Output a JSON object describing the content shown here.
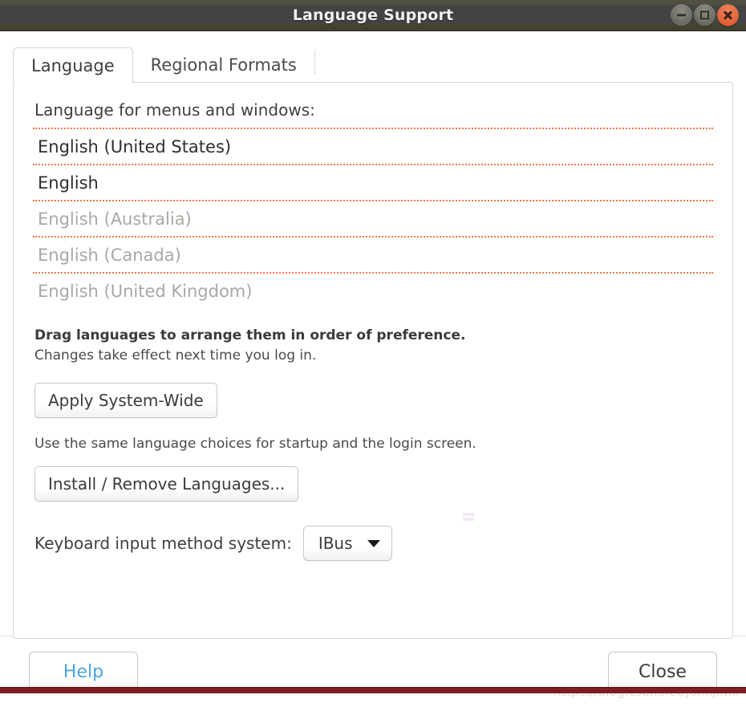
{
  "window": {
    "title": "Language Support",
    "controls": [
      {
        "name": "minimize",
        "icon": "minimize-icon",
        "label": "Minimize"
      },
      {
        "name": "maximize",
        "icon": "maximize-icon",
        "label": "Maximize"
      },
      {
        "name": "close",
        "icon": "close-icon",
        "label": "Close"
      }
    ]
  },
  "tabs": [
    {
      "label": "Language",
      "active": true
    },
    {
      "label": "Regional Formats",
      "active": false
    }
  ],
  "main": {
    "section_label": "Language for menus and windows:",
    "languages": [
      {
        "label": "English (United States)",
        "state": "active"
      },
      {
        "label": "English",
        "state": "active"
      },
      {
        "label": "English (Australia)",
        "state": "dim"
      },
      {
        "label": "English (Canada)",
        "state": "dim"
      },
      {
        "label": "English (United Kingdom)",
        "state": "dim"
      }
    ],
    "hint_bold": "Drag languages to arrange them in order of preference.",
    "hint_normal": "Changes take effect next time you log in.",
    "apply_button": "Apply System-Wide",
    "apply_caption": "Use the same language choices for startup and the login screen.",
    "install_button": "Install / Remove Languages...",
    "ime_label": "Keyboard input method system:",
    "ime_value": "IBus",
    "ime_options": [
      "IBus"
    ]
  },
  "footer": {
    "help_button": "Help",
    "close_button": "Close"
  },
  "watermark": "https://blog.csdn.net/JohnJim0",
  "colors": {
    "titlebar": "#434343",
    "titlebar_olive": "#4d4c3f",
    "close_button": "#e2653a",
    "dotted_separator": "#f2784b",
    "help_text": "#4da3de",
    "bottom_bar": "#7d1d22",
    "panel_border": "#d8d6d2",
    "dim_text": "#aaa8a4"
  }
}
